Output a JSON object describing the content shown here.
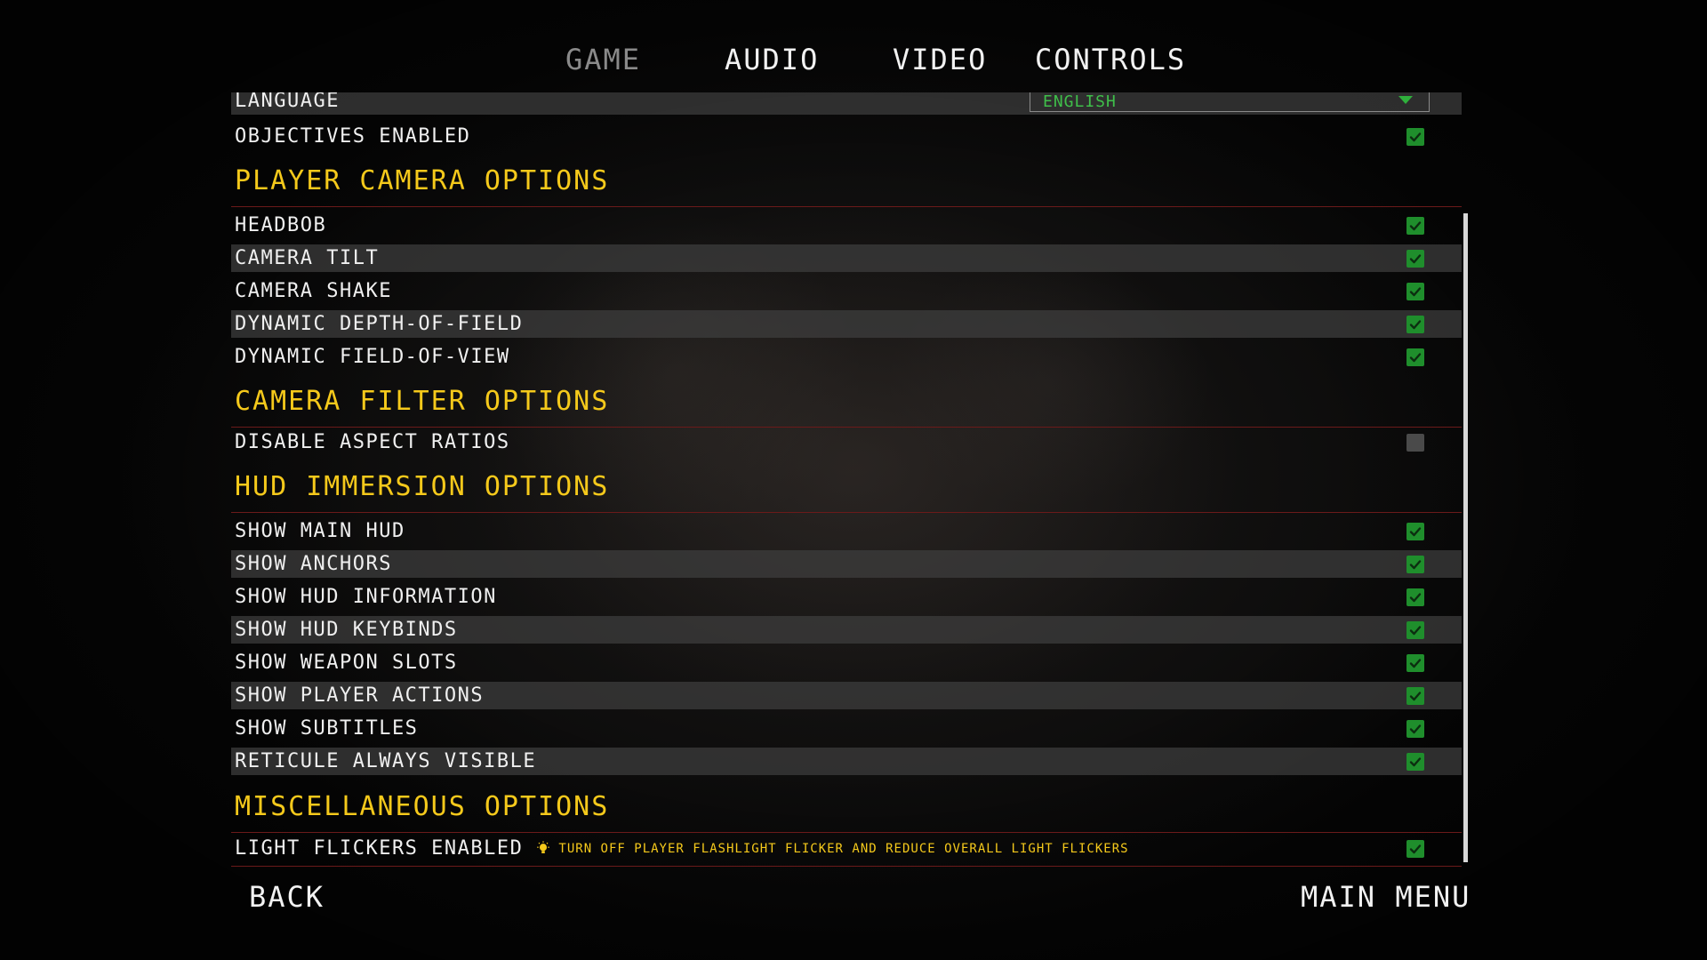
{
  "tabs": [
    {
      "label": "GAME",
      "active": true
    },
    {
      "label": "AUDIO",
      "active": false
    },
    {
      "label": "VIDEO",
      "active": false
    },
    {
      "label": "CONTROLS",
      "active": false
    }
  ],
  "general": {
    "language_label": "LANGUAGE",
    "language_value": "ENGLISH",
    "objectives_label": "OBJECTIVES ENABLED",
    "objectives_checked": true
  },
  "sections": {
    "player_camera": {
      "title": "PLAYER CAMERA OPTIONS",
      "options": [
        {
          "label": "HEADBOB",
          "checked": true
        },
        {
          "label": "CAMERA TILT",
          "checked": true
        },
        {
          "label": "CAMERA SHAKE",
          "checked": true
        },
        {
          "label": "DYNAMIC DEPTH-OF-FIELD",
          "checked": true
        },
        {
          "label": "DYNAMIC FIELD-OF-VIEW",
          "checked": true
        }
      ]
    },
    "camera_filter": {
      "title": "CAMERA FILTER OPTIONS",
      "options": [
        {
          "label": "DISABLE ASPECT RATIOS",
          "checked": false
        }
      ]
    },
    "hud_immersion": {
      "title": "HUD IMMERSION OPTIONS",
      "options": [
        {
          "label": "SHOW MAIN HUD",
          "checked": true
        },
        {
          "label": "SHOW ANCHORS",
          "checked": true
        },
        {
          "label": "SHOW HUD INFORMATION",
          "checked": true
        },
        {
          "label": "SHOW HUD KEYBINDS",
          "checked": true
        },
        {
          "label": "SHOW WEAPON SLOTS",
          "checked": true
        },
        {
          "label": "SHOW PLAYER ACTIONS",
          "checked": true
        },
        {
          "label": "SHOW SUBTITLES",
          "checked": true
        },
        {
          "label": "RETICULE ALWAYS VISIBLE",
          "checked": true
        }
      ]
    },
    "miscellaneous": {
      "title": "MISCELLANEOUS OPTIONS",
      "options": [
        {
          "label": "LIGHT FLICKERS ENABLED",
          "checked": true,
          "hint": "TURN OFF PLAYER FLASHLIGHT FLICKER AND REDUCE OVERALL LIGHT FLICKERS"
        }
      ]
    }
  },
  "footer": {
    "back_label": "BACK",
    "main_menu_label": "MAIN MENU"
  },
  "colors": {
    "accent_yellow": "#f5c91b",
    "check_green": "#1f8e2c",
    "divider_red": "#6b1a1a"
  }
}
